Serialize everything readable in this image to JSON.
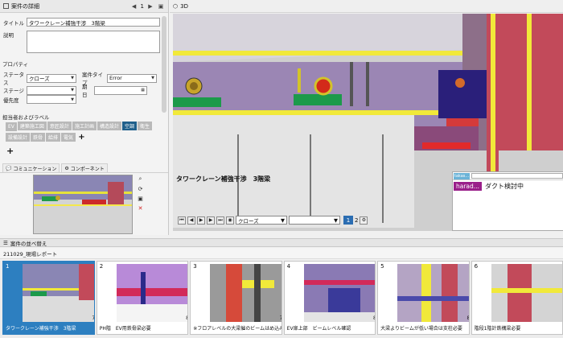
{
  "left_panel": {
    "header": "案件の詳細",
    "page_number": "1",
    "title_label": "タイトル",
    "title_value": "タワークレーン補強干渉　3階梁",
    "description_label": "説明",
    "properties_label": "プロパティ",
    "status_label": "ステータス",
    "status_value": "クローズ",
    "case_type_label": "案件タイプ",
    "case_type_value": "Error",
    "stage_label": "ステージ",
    "stage_value": "",
    "deadline_label": "期日",
    "deadline_value": "",
    "priority_label": "優先度",
    "priority_value": "",
    "assignees_label": "担当者およびラベル",
    "tags": [
      "EV",
      "建築施工図",
      "意匠設計",
      "施工計画",
      "構造設計",
      "空調",
      "衛生",
      "設備設計",
      "鉄骨",
      "給排",
      "電気"
    ],
    "active_tag": "空調",
    "add_symbol": "+",
    "tab_communication": "コミュニケーション",
    "tab_component": "コンポーネント"
  },
  "viewport": {
    "tab_label": "3D",
    "caption": "タワークレーン補強干渉　3階梁",
    "view_select": "クローズ",
    "second_select": "",
    "page_current": "1",
    "page_next": "2",
    "comment_user": "harad...",
    "comment_text": "ダクト検討中",
    "mini_label": "takas..."
  },
  "list": {
    "header": "案件の並べ替え",
    "report_name": "211029_現場レポート",
    "cards": [
      {
        "num": "1",
        "caption": "タワークレーン補強干渉　3階梁",
        "count": "79"
      },
      {
        "num": "2",
        "caption": "PH階　EV用鉄骨梁必要",
        "count": "82"
      },
      {
        "num": "3",
        "caption": "※フロアレベルの大梁催のビームはめ込み＝柱部...",
        "count": "77"
      },
      {
        "num": "4",
        "caption": "EV扉上部　ビームレベル確認",
        "count": "80"
      },
      {
        "num": "5",
        "caption": "大梁よりビームが低い場合は支柱必要",
        "count": "81"
      },
      {
        "num": "6",
        "caption": "階段1階計鉄構梁必要",
        "count": ""
      }
    ]
  }
}
